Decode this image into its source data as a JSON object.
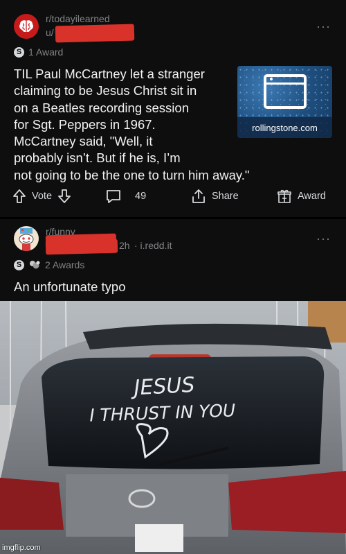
{
  "post1": {
    "subreddit": "r/todayilearned",
    "user_prefix": "u/",
    "award_count": "1 Award",
    "title_lines": [
      "TIL Paul McCartney let a stranger",
      "claiming to be Jesus Christ sit in",
      "on a Beatles recording session",
      "for Sgt. Peppers in 1967.",
      "McCartney said, \"Well, it",
      "probably isn’t. But if he is, I’m",
      "not going to be the one to turn him away.\""
    ],
    "link_domain": "rollingstone.com",
    "vote_label": "Vote",
    "comment_count": "49",
    "share_label": "Share",
    "award_label": "Award"
  },
  "post2": {
    "subreddit": "r/funny",
    "age": "2h",
    "source": "· i.redd.it",
    "award_count": "2 Awards",
    "title": "An unfortunate typo"
  },
  "photo": {
    "window_text_1": "JESUS",
    "window_text_2": "I THRUST IN YOU",
    "credit": "imgflip.com"
  },
  "colors": {
    "brand_red": "#d9322a",
    "background": "#0e0e0f",
    "text": "#d7dadc",
    "muted": "#818384"
  },
  "icons": [
    "reddit-til-icon",
    "reddit-funny-icon",
    "silver-award-icon",
    "helpful-award-icon",
    "upvote-icon",
    "downvote-icon",
    "comment-icon",
    "share-icon",
    "gift-award-icon",
    "more-options-icon",
    "browser-window-icon"
  ]
}
